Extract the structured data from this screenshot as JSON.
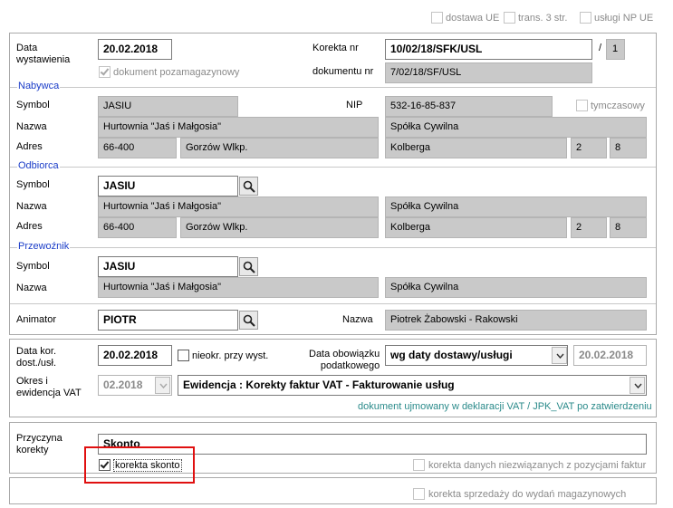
{
  "top_options": {
    "dostawa_ue": "dostawa UE",
    "trans_3_str": "trans. 3 str.",
    "uslugi_np_ue": "usługi NP UE"
  },
  "header": {
    "data_wystawienia_label": "Data\nwystawienia",
    "data_wystawienia_value": "20.02.2018",
    "dokument_pozamagazynowy": "dokument pozamagazynowy",
    "korekta_nr_label": "Korekta nr",
    "korekta_nr_value": "10/02/18/SFK/USL",
    "korekta_sep": "/",
    "korekta_suffix": "1",
    "dokumentu_nr_label": "dokumentu nr",
    "dokumentu_nr_value": "7/02/18/SF/USL"
  },
  "nabywca": {
    "title": "Nabywca",
    "symbol_label": "Symbol",
    "symbol_value": "JASIU",
    "nip_label": "NIP",
    "nip_value": "532-16-85-837",
    "tymczasowy": "tymczasowy",
    "nazwa_label": "Nazwa",
    "nazwa_value": "Hurtownia \"Jaś i Małgosia\"",
    "nazwa_value2": "Spółka Cywilna",
    "adres_label": "Adres",
    "kod": "66-400",
    "miasto": "Gorzów Wlkp.",
    "ulica": "Kolberga",
    "nr_domu": "2",
    "nr_lokalu": "8"
  },
  "odbiorca": {
    "title": "Odbiorca",
    "symbol_label": "Symbol",
    "symbol_value": "JASIU",
    "nazwa_label": "Nazwa",
    "nazwa_value": "Hurtownia \"Jaś i Małgosia\"",
    "nazwa_value2": "Spółka Cywilna",
    "adres_label": "Adres",
    "kod": "66-400",
    "miasto": "Gorzów Wlkp.",
    "ulica": "Kolberga",
    "nr_domu": "2",
    "nr_lokalu": "8"
  },
  "przewoznik": {
    "title": "Przewoźnik",
    "symbol_label": "Symbol",
    "symbol_value": "JASIU",
    "nazwa_label": "Nazwa",
    "nazwa_value": "Hurtownia \"Jaś i Małgosia\"",
    "nazwa_value2": "Spółka Cywilna"
  },
  "animator": {
    "label": "Animator",
    "value": "PIOTR",
    "nazwa_label": "Nazwa",
    "nazwa_value": "Piotrek Żabowski - Rakowski"
  },
  "dates": {
    "data_kor_label": "Data kor.\ndost./usł.",
    "data_kor_value": "20.02.2018",
    "nieokr_label": "nieokr. przy wyst.",
    "obowiazek_label": "Data obowiązku\npodatkowego",
    "obowiazek_select": "wg daty dostawy/usługi",
    "obowiazek_date": "20.02.2018",
    "okres_label": "Okres i\newidencja VAT",
    "okres_value": "02.2018",
    "ewidencja_value": "Ewidencja : Korekty faktur VAT - Fakturowanie usług",
    "jpk_note": "dokument ujmowany w deklaracji VAT / JPK_VAT po zatwierdzeniu"
  },
  "przyczyna": {
    "label": "Przyczyna\nkorekty",
    "value": "Skonto",
    "korekta_skonto": "korekta skonto",
    "korekta_niezwiazanych": "korekta danych niezwiązanych z pozycjami faktur"
  },
  "footer": {
    "korekta_sprzedazy": "korekta sprzedaży do wydań magazynowych"
  },
  "colors": {
    "section_title": "#1a3cc8",
    "readonly_bg": "#c9c9c9",
    "note_teal": "#2a8a8a",
    "highlight_box": "#e01010"
  }
}
